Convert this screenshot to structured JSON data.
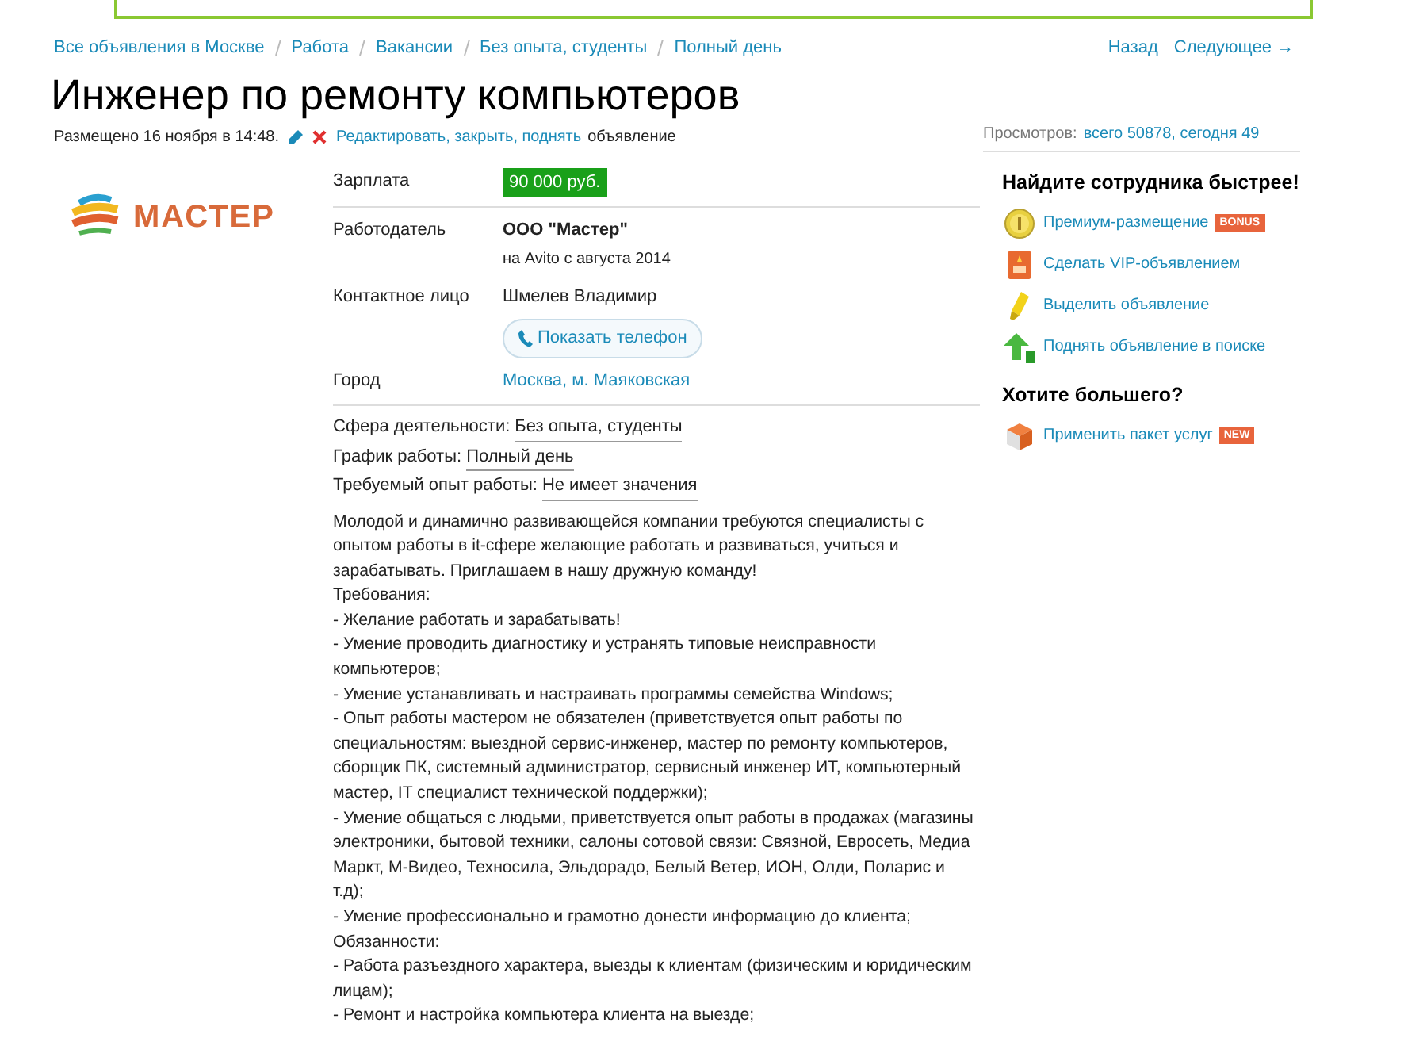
{
  "breadcrumbs": [
    "Все объявления в Москве",
    "Работа",
    "Вакансии",
    "Без опыта, студенты",
    "Полный день"
  ],
  "nav": {
    "back": "Назад",
    "next": "Следующее →"
  },
  "title": "Инженер по ремонту компьютеров",
  "meta": {
    "posted": "Размещено 16 ноября в 14:48.",
    "edit_link": "Редактировать, закрыть, поднять",
    "edit_suffix": "объявление",
    "views_label": "Просмотров:",
    "views_value": "всего 50878, сегодня 49"
  },
  "logo": {
    "text": "МАСТЕР"
  },
  "salary": {
    "label": "Зарплата",
    "value": "90 000 руб."
  },
  "employer": {
    "label": "Работодатель",
    "name": "ООО \"Мастер\"",
    "since": "на Avito с августа 2014"
  },
  "contact": {
    "label": "Контактное лицо",
    "name": "Шмелев Владимир",
    "phone_button": "Показать телефон"
  },
  "city": {
    "label": "Город",
    "value": "Москва, м. Маяковская"
  },
  "params": [
    {
      "label": "Сфера деятельности:",
      "value": "Без опыта, студенты"
    },
    {
      "label": "График работы:",
      "value": "Полный день"
    },
    {
      "label": "Требуемый опыт работы:",
      "value": "Не имеет значения"
    }
  ],
  "description": [
    "Молодой и динамично развивающейся компании требуются специалисты с опытом работы в it-сфере желающие работать и развиваться, учиться и зарабатывать. Приглашаем в нашу дружную команду!",
    "Требования:",
    "- Желание работать и зарабатывать!",
    "- Умение проводить диагностику и устранять типовые неисправности компьютеров;",
    "- Умение устанавливать и настраивать программы семейства Windows;",
    "- Опыт работы мастером не обязателен (приветствуется опыт работы по специальностям: выездной сервис-инженер, мастер по ремонту компьютеров, сборщик ПК, системный администратор, сервисный инженер ИТ, компьютерный мастер, IT специалист технической поддержки);",
    "- Умение общаться с людьми, приветствуется опыт работы в продажах (магазины электроники, бытовой техники, салоны сотовой связи: Связной, Евросеть, Медиа Маркт, М-Видео, Техносила, Эльдорадо, Белый Ветер, ИОН, Олди, Поларис и т.д);",
    "- Умение профессионально и грамотно донести информацию до клиента;",
    "Обязанности:",
    "- Работа разъездного характера, выезды к клиентам (физическим и юридическим лицам);",
    "- Ремонт и настройка компьютера клиента на выезде;"
  ],
  "sidebar": [
    {
      "heading": "Найдите сотрудника быстрее!",
      "items": [
        {
          "kind": "coin",
          "label": "Премиум-размещение",
          "badge": "BONUS"
        },
        {
          "kind": "vip",
          "label": "Сделать VIP-объявлением"
        },
        {
          "kind": "marker",
          "label": "Выделить объявление"
        },
        {
          "kind": "up",
          "label": "Поднять объявление в поиске"
        }
      ]
    },
    {
      "heading": "Хотите большего?",
      "items": [
        {
          "kind": "box",
          "label": "Применить пакет услуг",
          "badge": "NEW"
        }
      ]
    }
  ]
}
